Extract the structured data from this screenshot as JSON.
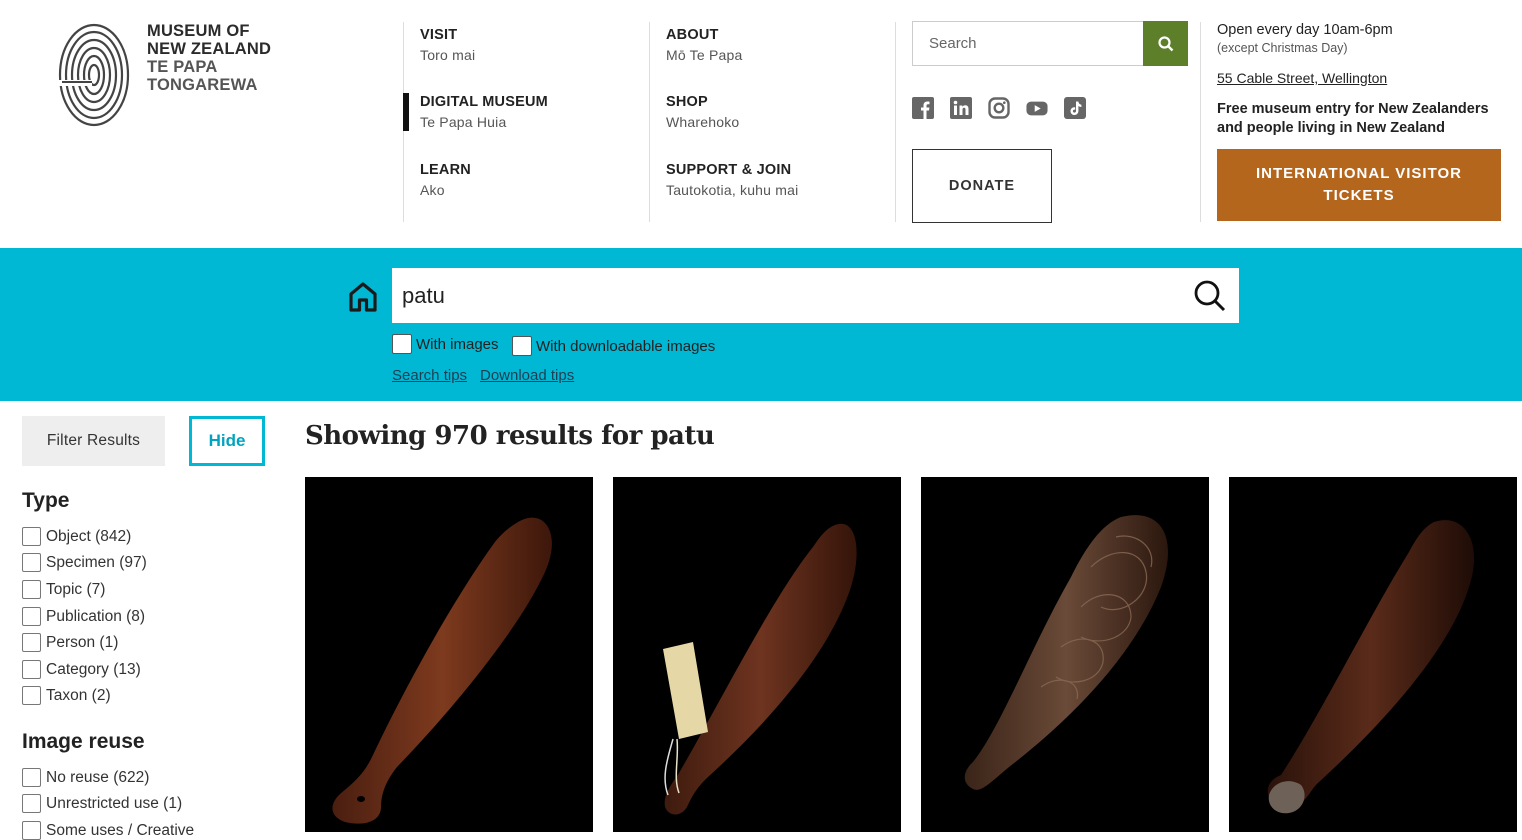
{
  "logo": {
    "line1": "MUSEUM OF",
    "line2": "NEW ZEALAND",
    "line3": "TE PAPA",
    "line4": "TONGAREWA"
  },
  "nav": {
    "visit": {
      "title": "VISIT",
      "sub": "Toro mai"
    },
    "digital": {
      "title": "DIGITAL MUSEUM",
      "sub": "Te Papa Huia"
    },
    "learn": {
      "title": "LEARN",
      "sub": "Ako"
    },
    "about": {
      "title": "ABOUT",
      "sub": "Mō Te Papa"
    },
    "shop": {
      "title": "SHOP",
      "sub": "Wharehoko"
    },
    "support": {
      "title": "SUPPORT & JOIN",
      "sub": "Tautokotia, kuhu mai"
    }
  },
  "header_search": {
    "placeholder": "Search"
  },
  "social": [
    "facebook-icon",
    "linkedin-icon",
    "instagram-icon",
    "youtube-icon",
    "tiktok-icon"
  ],
  "donate_label": "DONATE",
  "info": {
    "hours": "Open every day 10am-6pm",
    "hours_note": "(except Christmas Day)",
    "address": "55 Cable Street, Wellington",
    "free_entry": "Free museum entry for New Zealanders and people living in New Zealand",
    "tickets_label": "INTERNATIONAL VISITOR TICKETS"
  },
  "search": {
    "value": "patu",
    "with_images": "With images",
    "with_downloadable": "With downloadable images",
    "search_tips": "Search tips",
    "download_tips": "Download tips"
  },
  "sidebar": {
    "filter_label": "Filter Results",
    "hide_label": "Hide",
    "type_heading": "Type",
    "types": [
      "Object (842)",
      "Specimen (97)",
      "Topic (7)",
      "Publication (8)",
      "Person (1)",
      "Category (13)",
      "Taxon (2)"
    ],
    "reuse_heading": "Image reuse",
    "reuse": [
      "No reuse (622)",
      "Unrestricted use (1)",
      "Some uses / Creative"
    ]
  },
  "results": {
    "title": "Showing 970 results for patu"
  },
  "colors": {
    "band": "#00b7d4",
    "search_button": "#5e7f2a",
    "tickets": "#b5661d"
  }
}
